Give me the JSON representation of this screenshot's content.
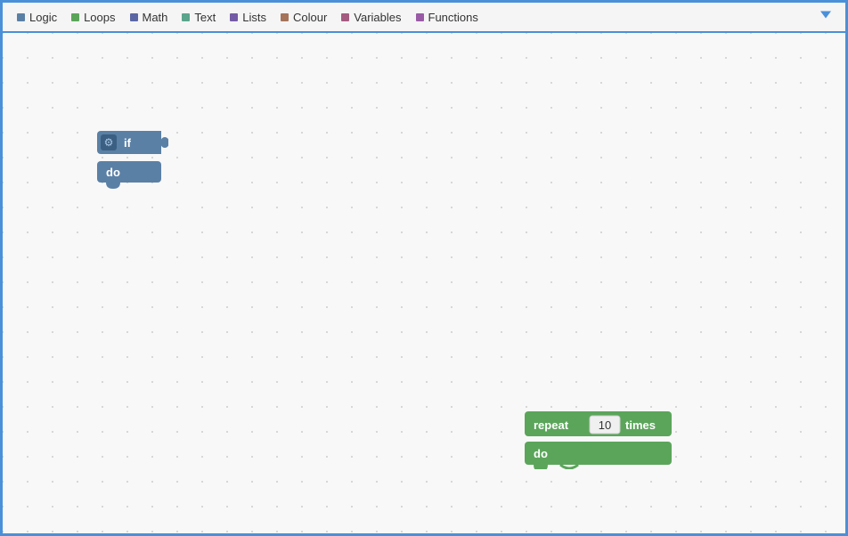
{
  "toolbar": {
    "items": [
      {
        "label": "Logic",
        "color": "#5b80a5",
        "id": "logic"
      },
      {
        "label": "Loops",
        "color": "#5ba55b",
        "id": "loops"
      },
      {
        "label": "Math",
        "color": "#5b67a5",
        "id": "math"
      },
      {
        "label": "Text",
        "color": "#5ba58c",
        "id": "text"
      },
      {
        "label": "Lists",
        "color": "#745ba5",
        "id": "lists"
      },
      {
        "label": "Colour",
        "color": "#a5745b",
        "id": "colour"
      },
      {
        "label": "Variables",
        "color": "#a55b80",
        "id": "variables"
      },
      {
        "label": "Functions",
        "color": "#995ba5",
        "id": "functions"
      }
    ]
  },
  "blocks": {
    "if_block": {
      "top_label": "if",
      "bottom_label": "do"
    },
    "repeat_block": {
      "repeat_label": "repeat",
      "value": "10",
      "times_label": "times",
      "do_label": "do"
    }
  },
  "icons": {
    "gear": "⚙",
    "arrow_down": "▼"
  }
}
